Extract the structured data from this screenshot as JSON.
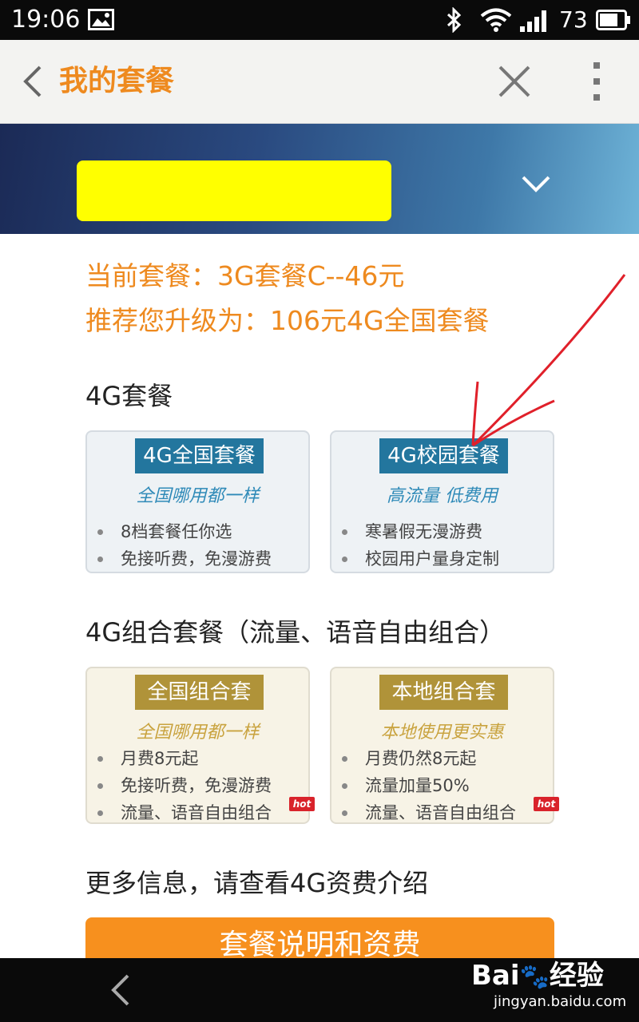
{
  "status_bar": {
    "time": "19:06",
    "battery_level": "73",
    "icons": [
      "image-icon",
      "bluetooth-icon",
      "wifi-icon",
      "signal-icon",
      "battery-icon"
    ]
  },
  "header": {
    "title": "我的套餐",
    "title_color": "#ee8a1f",
    "icons": [
      "back-icon",
      "close-icon",
      "more-icon"
    ]
  },
  "banner": {
    "redaction_color": "#ffff00",
    "icon": "chevron-down-icon"
  },
  "info": {
    "current_plan": "当前套餐：3G套餐C--46元",
    "recommend": "推荐您升级为：106元4G全国套餐"
  },
  "sections": {
    "plans_4g": {
      "title": "4G套餐",
      "cards": [
        {
          "name": "4G全国套餐",
          "slogan": "全国哪用都一样",
          "bullets": [
            "8档套餐任你选",
            "免接听费，免漫游费"
          ]
        },
        {
          "name": "4G校园套餐",
          "slogan": "高流量 低费用",
          "bullets": [
            "寒暑假无漫游费",
            "校园用户量身定制"
          ]
        }
      ]
    },
    "combo_4g": {
      "title": "4G组合套餐（流量、语音自由组合）",
      "cards": [
        {
          "name": "全国组合套",
          "slogan": "全国哪用都一样",
          "bullets": [
            "月费8元起",
            "免接听费，免漫游费",
            "流量、语音自由组合"
          ],
          "badge": "hot"
        },
        {
          "name": "本地组合套",
          "slogan": "本地使用更实惠",
          "bullets": [
            "月费仍然8元起",
            "流量加量50%",
            "流量、语音自由组合"
          ],
          "badge": "hot"
        }
      ]
    },
    "more": {
      "title": "更多信息，请查看4G资费介绍"
    }
  },
  "cta": {
    "label": "套餐说明和资费",
    "color": "#f7901e"
  },
  "watermark": {
    "logo": "Bai",
    "logo_suffix": "经验",
    "url": "jingyan.baidu.com"
  },
  "colors": {
    "blue_ribbon": "#23769e",
    "gold_ribbon": "#b09339",
    "annotation_arrow": "#e0202a"
  }
}
